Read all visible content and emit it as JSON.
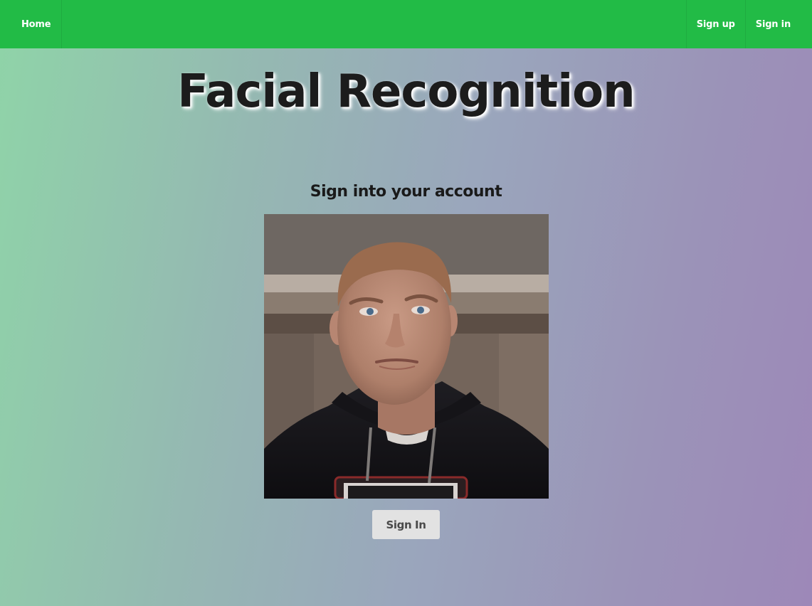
{
  "nav": {
    "home_label": "Home",
    "signup_label": "Sign up",
    "signin_label": "Sign in"
  },
  "main": {
    "title": "Facial Recognition",
    "subtitle": "Sign into your account",
    "photo_icon": "webcam-face-capture",
    "signin_button_label": "Sign In"
  },
  "colors": {
    "navbar": "#22bb46",
    "button": "#e2e2e2",
    "gradient_start": "#8fd4a8",
    "gradient_end": "#9d88b8"
  }
}
